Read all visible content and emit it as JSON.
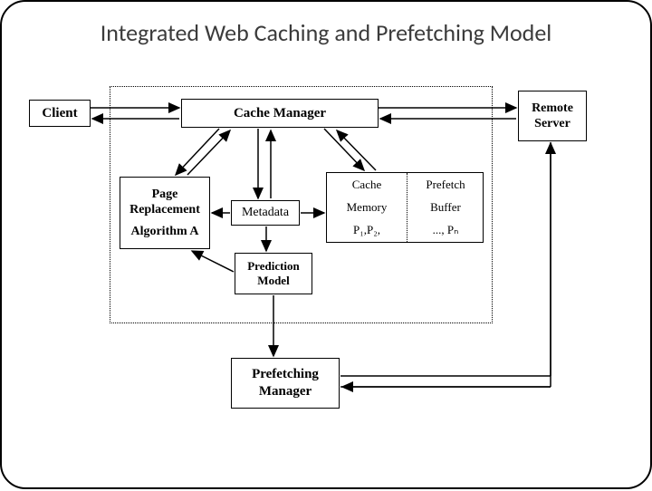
{
  "title": "Integrated Web Caching and Prefetching Model",
  "nodes": {
    "client": "Client",
    "cache_manager": "Cache Manager",
    "remote_server_l1": "Remote",
    "remote_server_l2": "Server",
    "page_replacement_l1": "Page",
    "page_replacement_l2": "Replacement",
    "page_replacement_l3": "Algorithm A",
    "metadata": "Metadata",
    "cache_memory_l1": "Cache",
    "cache_memory_l2": "Memory",
    "cache_memory_l3": "P₁,P₂,",
    "prefetch_buffer_l1": "Prefetch",
    "prefetch_buffer_l2": "Buffer",
    "prefetch_buffer_l3": "..., Pₙ",
    "prediction_model_l1": "Prediction",
    "prediction_model_l2": "Model",
    "prefetching_manager_l1": "Prefetching",
    "prefetching_manager_l2": "Manager"
  }
}
